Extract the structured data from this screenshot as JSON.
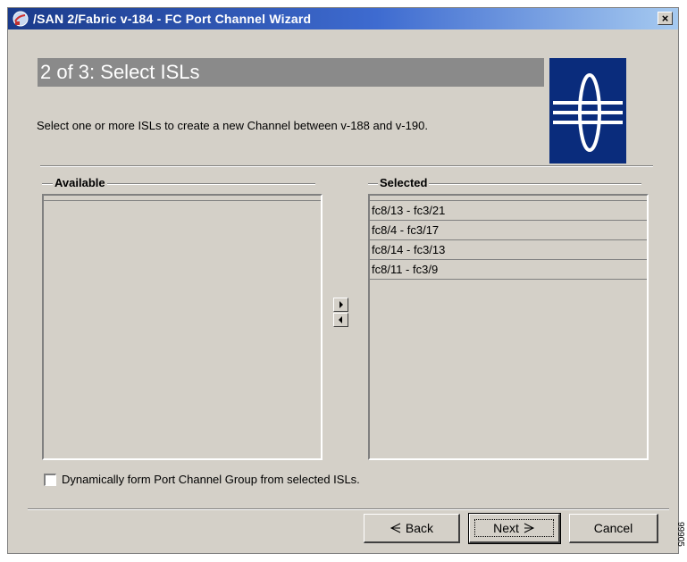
{
  "window": {
    "title": "/SAN 2/Fabric v-184 - FC Port Channel Wizard",
    "close_label": "×",
    "app_icon": "globe-icon",
    "titlebar_color": "#1a3a8a"
  },
  "wizard": {
    "step_title": "2 of 3: Select ISLs",
    "description": "Select one or more ISLs to create a new Channel between v-188 and v-190.",
    "logo_icon": "cisco-fabric-logo-icon",
    "logo_color": "#0a2c7c",
    "banner_color": "#8a8a8a"
  },
  "available": {
    "label": "Available",
    "items": []
  },
  "selected": {
    "label": "Selected",
    "items": [
      "fc8/13 - fc3/21",
      "fc8/4 - fc3/17",
      "fc8/14 - fc3/13",
      "fc8/11 - fc3/9"
    ]
  },
  "transfer": {
    "add_icon": "arrow-right-icon",
    "remove_icon": "arrow-left-icon"
  },
  "options": {
    "dynamic_label": "Dynamically form Port Channel Group from selected ISLs.",
    "dynamic_checked": false
  },
  "footer": {
    "back_label": "Back",
    "next_label": "Next",
    "cancel_label": "Cancel",
    "back_icon": "back-triangle-icon",
    "next_icon": "next-triangle-icon"
  },
  "side_mark": "99905"
}
